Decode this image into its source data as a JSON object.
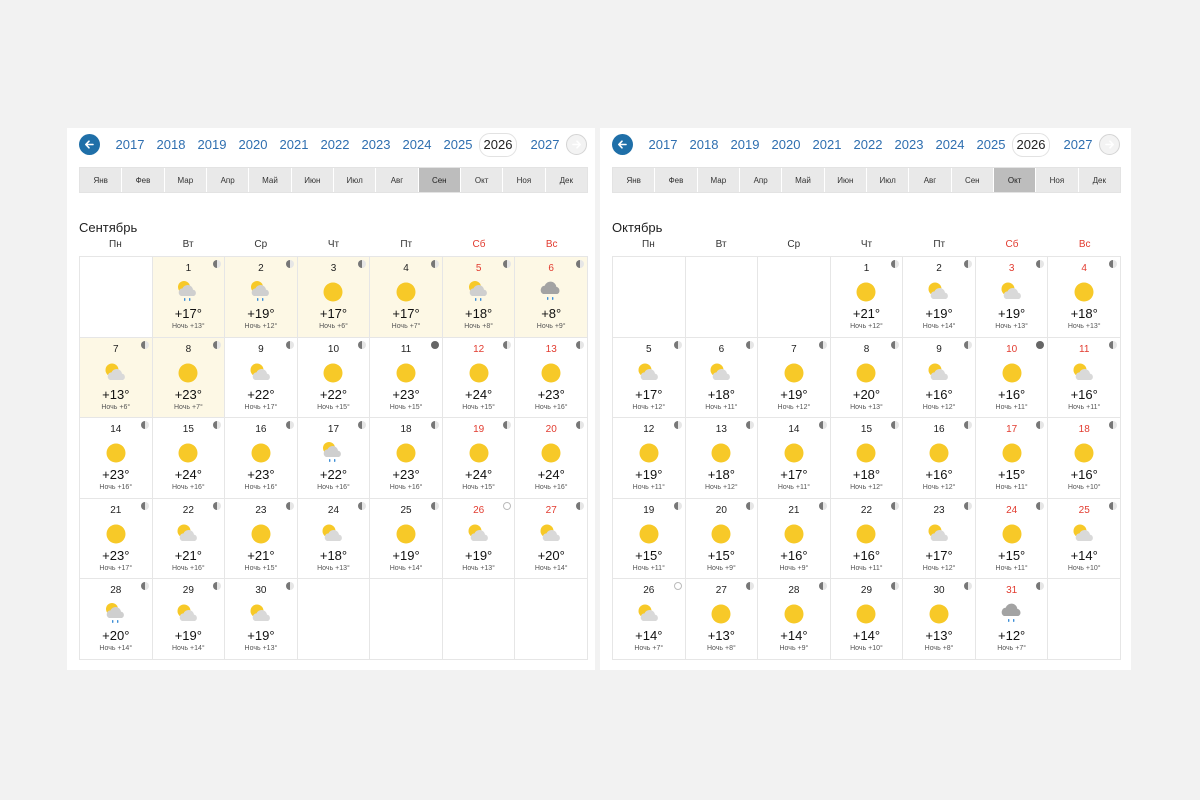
{
  "years": [
    "2017",
    "2018",
    "2019",
    "2020",
    "2021",
    "2022",
    "2023",
    "2024",
    "2025",
    "2026",
    "2027"
  ],
  "active_year": "2026",
  "months": [
    "Янв",
    "Фев",
    "Мар",
    "Апр",
    "Май",
    "Июн",
    "Июл",
    "Авг",
    "Сен",
    "Окт",
    "Ноя",
    "Дек"
  ],
  "weekdays": [
    "Пн",
    "Вт",
    "Ср",
    "Чт",
    "Пт",
    "Сб",
    "Вс"
  ],
  "night_label": "Ночь",
  "icons": {
    "sunny": "sun-icon",
    "partly": "sun-cloud-icon",
    "rain_sun": "sun-cloud-rain-icon",
    "rain": "rain-cloud-icon"
  },
  "colors": {
    "link": "#2f6fb0",
    "weekend": "#e23b2f",
    "sun": "#f7c928",
    "highlight": "#fdf8e5"
  },
  "calendars": [
    {
      "title": "Сентябрь",
      "active_month": 8,
      "offset": 1,
      "days": [
        {
          "d": 1,
          "w": "rain_sun",
          "t": "+17°",
          "n": "+13°",
          "m": "half",
          "hl": true
        },
        {
          "d": 2,
          "w": "rain_sun",
          "t": "+19°",
          "n": "+12°",
          "m": "half",
          "hl": true
        },
        {
          "d": 3,
          "w": "sunny",
          "t": "+17°",
          "n": "+6°",
          "m": "half",
          "hl": true
        },
        {
          "d": 4,
          "w": "sunny",
          "t": "+17°",
          "n": "+7°",
          "m": "half",
          "hl": true
        },
        {
          "d": 5,
          "w": "rain_sun",
          "t": "+18°",
          "n": "+8°",
          "m": "half",
          "hl": true
        },
        {
          "d": 6,
          "w": "rain",
          "t": "+8°",
          "n": "+9°",
          "m": "half",
          "hl": true
        },
        {
          "d": 7,
          "w": "partly",
          "t": "+13°",
          "n": "+6°",
          "m": "half",
          "hl": true
        },
        {
          "d": 8,
          "w": "sunny",
          "t": "+23°",
          "n": "+7°",
          "m": "half",
          "hl": true
        },
        {
          "d": 9,
          "w": "partly",
          "t": "+22°",
          "n": "+17°",
          "m": "half"
        },
        {
          "d": 10,
          "w": "sunny",
          "t": "+22°",
          "n": "+15°",
          "m": "half"
        },
        {
          "d": 11,
          "w": "sunny",
          "t": "+23°",
          "n": "+15°",
          "m": "dark"
        },
        {
          "d": 12,
          "w": "sunny",
          "t": "+24°",
          "n": "+15°",
          "m": "half"
        },
        {
          "d": 13,
          "w": "sunny",
          "t": "+23°",
          "n": "+16°",
          "m": "half"
        },
        {
          "d": 14,
          "w": "sunny",
          "t": "+23°",
          "n": "+16°",
          "m": "half"
        },
        {
          "d": 15,
          "w": "sunny",
          "t": "+24°",
          "n": "+16°",
          "m": "half"
        },
        {
          "d": 16,
          "w": "sunny",
          "t": "+23°",
          "n": "+16°",
          "m": "half"
        },
        {
          "d": 17,
          "w": "rain_sun",
          "t": "+22°",
          "n": "+16°",
          "m": "half"
        },
        {
          "d": 18,
          "w": "sunny",
          "t": "+23°",
          "n": "+16°",
          "m": "half"
        },
        {
          "d": 19,
          "w": "sunny",
          "t": "+24°",
          "n": "+15°",
          "m": "half"
        },
        {
          "d": 20,
          "w": "sunny",
          "t": "+24°",
          "n": "+16°",
          "m": "half"
        },
        {
          "d": 21,
          "w": "sunny",
          "t": "+23°",
          "n": "+17°",
          "m": "half"
        },
        {
          "d": 22,
          "w": "partly",
          "t": "+21°",
          "n": "+16°",
          "m": "half"
        },
        {
          "d": 23,
          "w": "sunny",
          "t": "+21°",
          "n": "+15°",
          "m": "half"
        },
        {
          "d": 24,
          "w": "partly",
          "t": "+18°",
          "n": "+13°",
          "m": "half"
        },
        {
          "d": 25,
          "w": "sunny",
          "t": "+19°",
          "n": "+14°",
          "m": "half"
        },
        {
          "d": 26,
          "w": "partly",
          "t": "+19°",
          "n": "+13°",
          "m": "full"
        },
        {
          "d": 27,
          "w": "partly",
          "t": "+20°",
          "n": "+14°",
          "m": "half"
        },
        {
          "d": 28,
          "w": "rain_sun",
          "t": "+20°",
          "n": "+14°",
          "m": "half"
        },
        {
          "d": 29,
          "w": "partly",
          "t": "+19°",
          "n": "+14°",
          "m": "half"
        },
        {
          "d": 30,
          "w": "partly",
          "t": "+19°",
          "n": "+13°",
          "m": "half"
        }
      ]
    },
    {
      "title": "Октябрь",
      "active_month": 9,
      "offset": 3,
      "days": [
        {
          "d": 1,
          "w": "sunny",
          "t": "+21°",
          "n": "+12°",
          "m": "half"
        },
        {
          "d": 2,
          "w": "partly",
          "t": "+19°",
          "n": "+14°",
          "m": "half"
        },
        {
          "d": 3,
          "w": "partly",
          "t": "+19°",
          "n": "+13°",
          "m": "half"
        },
        {
          "d": 4,
          "w": "sunny",
          "t": "+18°",
          "n": "+13°",
          "m": "half"
        },
        {
          "d": 5,
          "w": "partly",
          "t": "+17°",
          "n": "+12°",
          "m": "half"
        },
        {
          "d": 6,
          "w": "partly",
          "t": "+18°",
          "n": "+11°",
          "m": "half"
        },
        {
          "d": 7,
          "w": "sunny",
          "t": "+19°",
          "n": "+12°",
          "m": "half"
        },
        {
          "d": 8,
          "w": "sunny",
          "t": "+20°",
          "n": "+13°",
          "m": "half"
        },
        {
          "d": 9,
          "w": "partly",
          "t": "+16°",
          "n": "+12°",
          "m": "half"
        },
        {
          "d": 10,
          "w": "sunny",
          "t": "+16°",
          "n": "+11°",
          "m": "dark"
        },
        {
          "d": 11,
          "w": "partly",
          "t": "+16°",
          "n": "+11°",
          "m": "half"
        },
        {
          "d": 12,
          "w": "sunny",
          "t": "+19°",
          "n": "+11°",
          "m": "half"
        },
        {
          "d": 13,
          "w": "sunny",
          "t": "+18°",
          "n": "+12°",
          "m": "half"
        },
        {
          "d": 14,
          "w": "sunny",
          "t": "+17°",
          "n": "+11°",
          "m": "half"
        },
        {
          "d": 15,
          "w": "sunny",
          "t": "+18°",
          "n": "+12°",
          "m": "half"
        },
        {
          "d": 16,
          "w": "sunny",
          "t": "+16°",
          "n": "+12°",
          "m": "half"
        },
        {
          "d": 17,
          "w": "sunny",
          "t": "+15°",
          "n": "+11°",
          "m": "half"
        },
        {
          "d": 18,
          "w": "sunny",
          "t": "+16°",
          "n": "+10°",
          "m": "half"
        },
        {
          "d": 19,
          "w": "sunny",
          "t": "+15°",
          "n": "+11°",
          "m": "half"
        },
        {
          "d": 20,
          "w": "sunny",
          "t": "+15°",
          "n": "+9°",
          "m": "half"
        },
        {
          "d": 21,
          "w": "sunny",
          "t": "+16°",
          "n": "+9°",
          "m": "half"
        },
        {
          "d": 22,
          "w": "sunny",
          "t": "+16°",
          "n": "+11°",
          "m": "half"
        },
        {
          "d": 23,
          "w": "partly",
          "t": "+17°",
          "n": "+12°",
          "m": "half"
        },
        {
          "d": 24,
          "w": "sunny",
          "t": "+15°",
          "n": "+11°",
          "m": "half"
        },
        {
          "d": 25,
          "w": "partly",
          "t": "+14°",
          "n": "+10°",
          "m": "half"
        },
        {
          "d": 26,
          "w": "partly",
          "t": "+14°",
          "n": "+7°",
          "m": "full"
        },
        {
          "d": 27,
          "w": "sunny",
          "t": "+13°",
          "n": "+8°",
          "m": "half"
        },
        {
          "d": 28,
          "w": "sunny",
          "t": "+14°",
          "n": "+9°",
          "m": "half"
        },
        {
          "d": 29,
          "w": "sunny",
          "t": "+14°",
          "n": "+10°",
          "m": "half"
        },
        {
          "d": 30,
          "w": "sunny",
          "t": "+13°",
          "n": "+8°",
          "m": "half"
        },
        {
          "d": 31,
          "w": "rain",
          "t": "+12°",
          "n": "+7°",
          "m": "half"
        }
      ]
    }
  ]
}
